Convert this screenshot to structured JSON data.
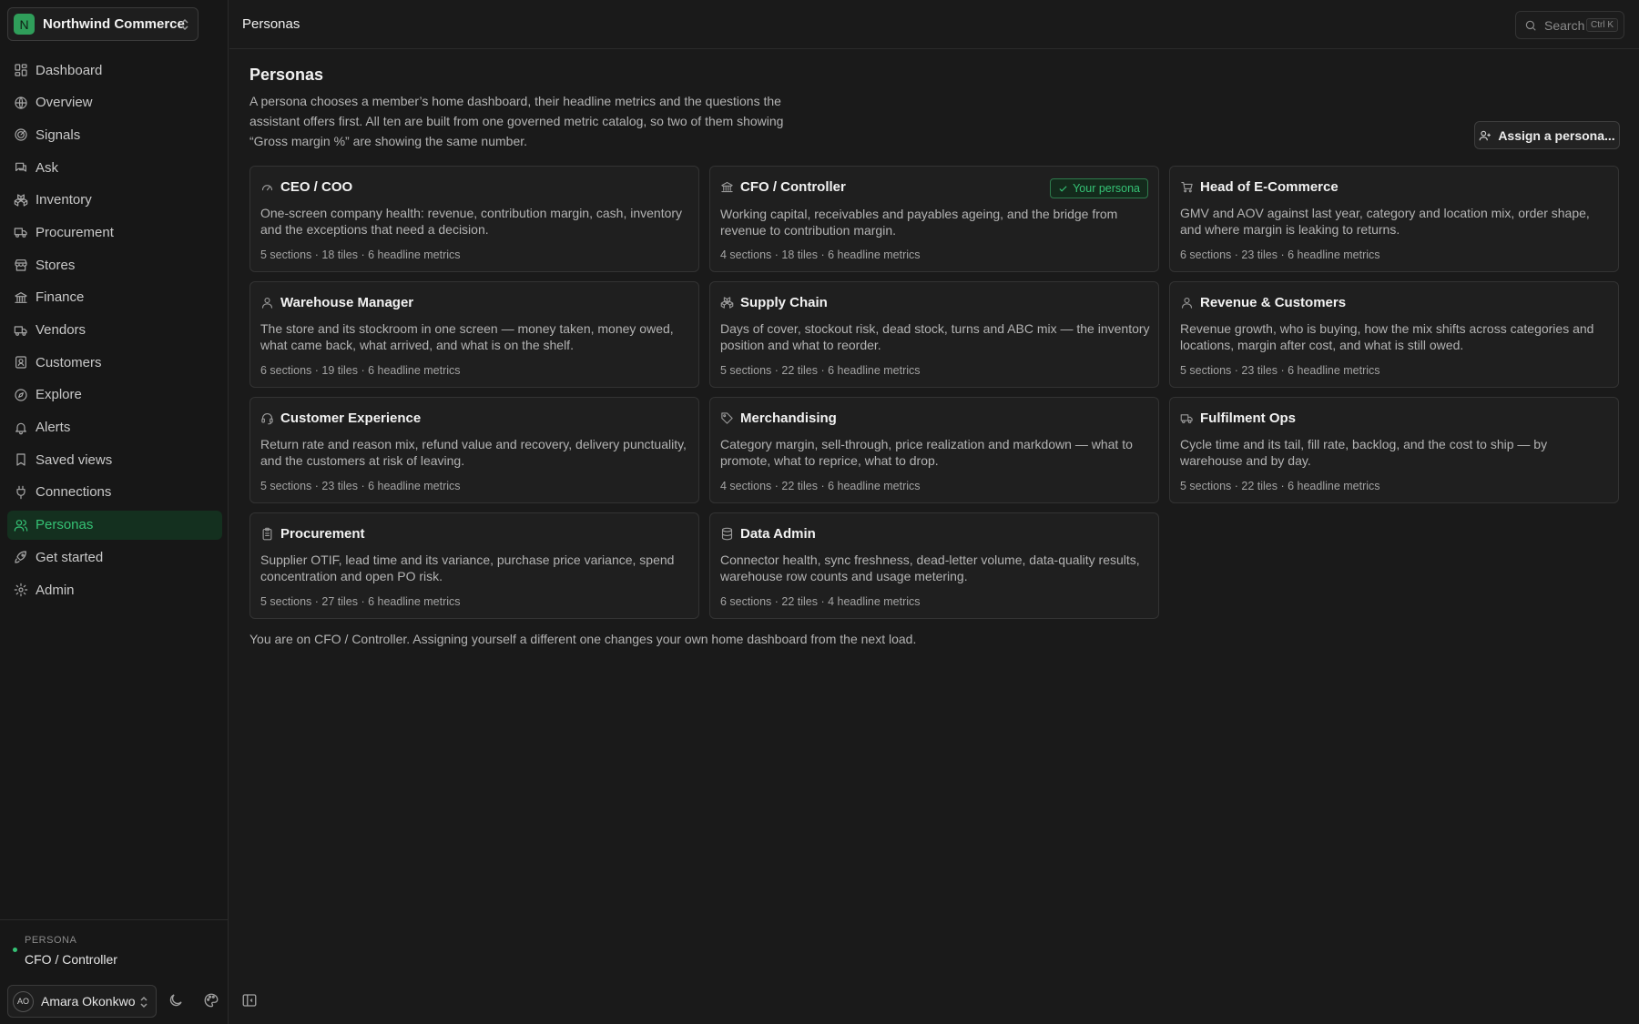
{
  "org": {
    "initial": "N",
    "name": "Northwind Commerce"
  },
  "sidebar": {
    "items": [
      {
        "label": "Dashboard",
        "icon": "dashboard-icon"
      },
      {
        "label": "Overview",
        "icon": "globe-icon"
      },
      {
        "label": "Signals",
        "icon": "radar-icon"
      },
      {
        "label": "Ask",
        "icon": "chat-icon"
      },
      {
        "label": "Inventory",
        "icon": "boxes-icon"
      },
      {
        "label": "Procurement",
        "icon": "truck-icon"
      },
      {
        "label": "Stores",
        "icon": "store-icon"
      },
      {
        "label": "Finance",
        "icon": "bank-icon"
      },
      {
        "label": "Vendors",
        "icon": "vendor-truck-icon"
      },
      {
        "label": "Customers",
        "icon": "contact-icon"
      },
      {
        "label": "Explore",
        "icon": "compass-icon"
      },
      {
        "label": "Alerts",
        "icon": "bell-icon"
      },
      {
        "label": "Saved views",
        "icon": "bookmark-icon"
      },
      {
        "label": "Connections",
        "icon": "plug-icon"
      },
      {
        "label": "Personas",
        "icon": "users-icon",
        "active": true
      },
      {
        "label": "Get started",
        "icon": "rocket-icon"
      },
      {
        "label": "Admin",
        "icon": "gear-icon"
      }
    ],
    "persona_kicker": "PERSONA",
    "persona_name": "CFO / Controller",
    "user_initials": "AO",
    "user_name": "Amara Okonkwo"
  },
  "header": {
    "breadcrumb": "Personas",
    "search_label": "Search",
    "search_shortcut": "Ctrl K"
  },
  "main": {
    "title": "Personas",
    "description": "A persona chooses a member’s home dashboard, their headline metrics and the questions the assistant offers first. All ten are built from one governed metric catalog, so two of them showing “Gross margin %” are showing the same number.",
    "assign_label": "Assign a persona...",
    "your_persona_label": "Your persona",
    "footnote": "You are on CFO / Controller. Assigning yourself a different one changes your own home dashboard from the next load.",
    "cards": [
      {
        "title": "CEO / COO",
        "icon": "gauge-icon",
        "desc": "One-screen company health: revenue, contribution margin, cash, inventory and the exceptions that need a decision.",
        "meta": "5 sections · 18 tiles · 6 headline metrics"
      },
      {
        "title": "CFO / Controller",
        "icon": "bank-icon",
        "desc": "Working capital, receivables and payables ageing, and the bridge from revenue to contribution margin.",
        "meta": "4 sections · 18 tiles · 6 headline metrics",
        "current": true
      },
      {
        "title": "Head of E-Commerce",
        "icon": "cart-icon",
        "desc": "GMV and AOV against last year, category and location mix, order shape, and where margin is leaking to returns.",
        "meta": "6 sections · 23 tiles · 6 headline metrics"
      },
      {
        "title": "Warehouse Manager",
        "icon": "user-icon",
        "desc": "The store and its stockroom in one screen — money taken, money owed, what came back, what arrived, and what is on the shelf.",
        "meta": "6 sections · 19 tiles · 6 headline metrics"
      },
      {
        "title": "Supply Chain",
        "icon": "boxes-icon",
        "desc": "Days of cover, stockout risk, dead stock, turns and ABC mix — the inventory position and what to reorder.",
        "meta": "5 sections · 22 tiles · 6 headline metrics"
      },
      {
        "title": "Revenue & Customers",
        "icon": "user-icon",
        "desc": "Revenue growth, who is buying, how the mix shifts across categories and locations, margin after cost, and what is still owed.",
        "meta": "5 sections · 23 tiles · 6 headline metrics"
      },
      {
        "title": "Customer Experience",
        "icon": "headset-icon",
        "desc": "Return rate and reason mix, refund value and recovery, delivery punctuality, and the customers at risk of leaving.",
        "meta": "5 sections · 23 tiles · 6 headline metrics"
      },
      {
        "title": "Merchandising",
        "icon": "tag-icon",
        "desc": "Category margin, sell-through, price realization and markdown — what to promote, what to reprice, what to drop.",
        "meta": "4 sections · 22 tiles · 6 headline metrics"
      },
      {
        "title": "Fulfilment Ops",
        "icon": "truck-icon",
        "desc": "Cycle time and its tail, fill rate, backlog, and the cost to ship — by warehouse and by day.",
        "meta": "5 sections · 22 tiles · 6 headline metrics"
      },
      {
        "title": "Procurement",
        "icon": "clipboard-icon",
        "desc": "Supplier OTIF, lead time and its variance, purchase price variance, spend concentration and open PO risk.",
        "meta": "5 sections · 27 tiles · 6 headline metrics"
      },
      {
        "title": "Data Admin",
        "icon": "database-icon",
        "desc": "Connector health, sync freshness, dead-letter volume, data-quality results, warehouse row counts and usage metering.",
        "meta": "6 sections · 22 tiles · 4 headline metrics"
      }
    ]
  }
}
